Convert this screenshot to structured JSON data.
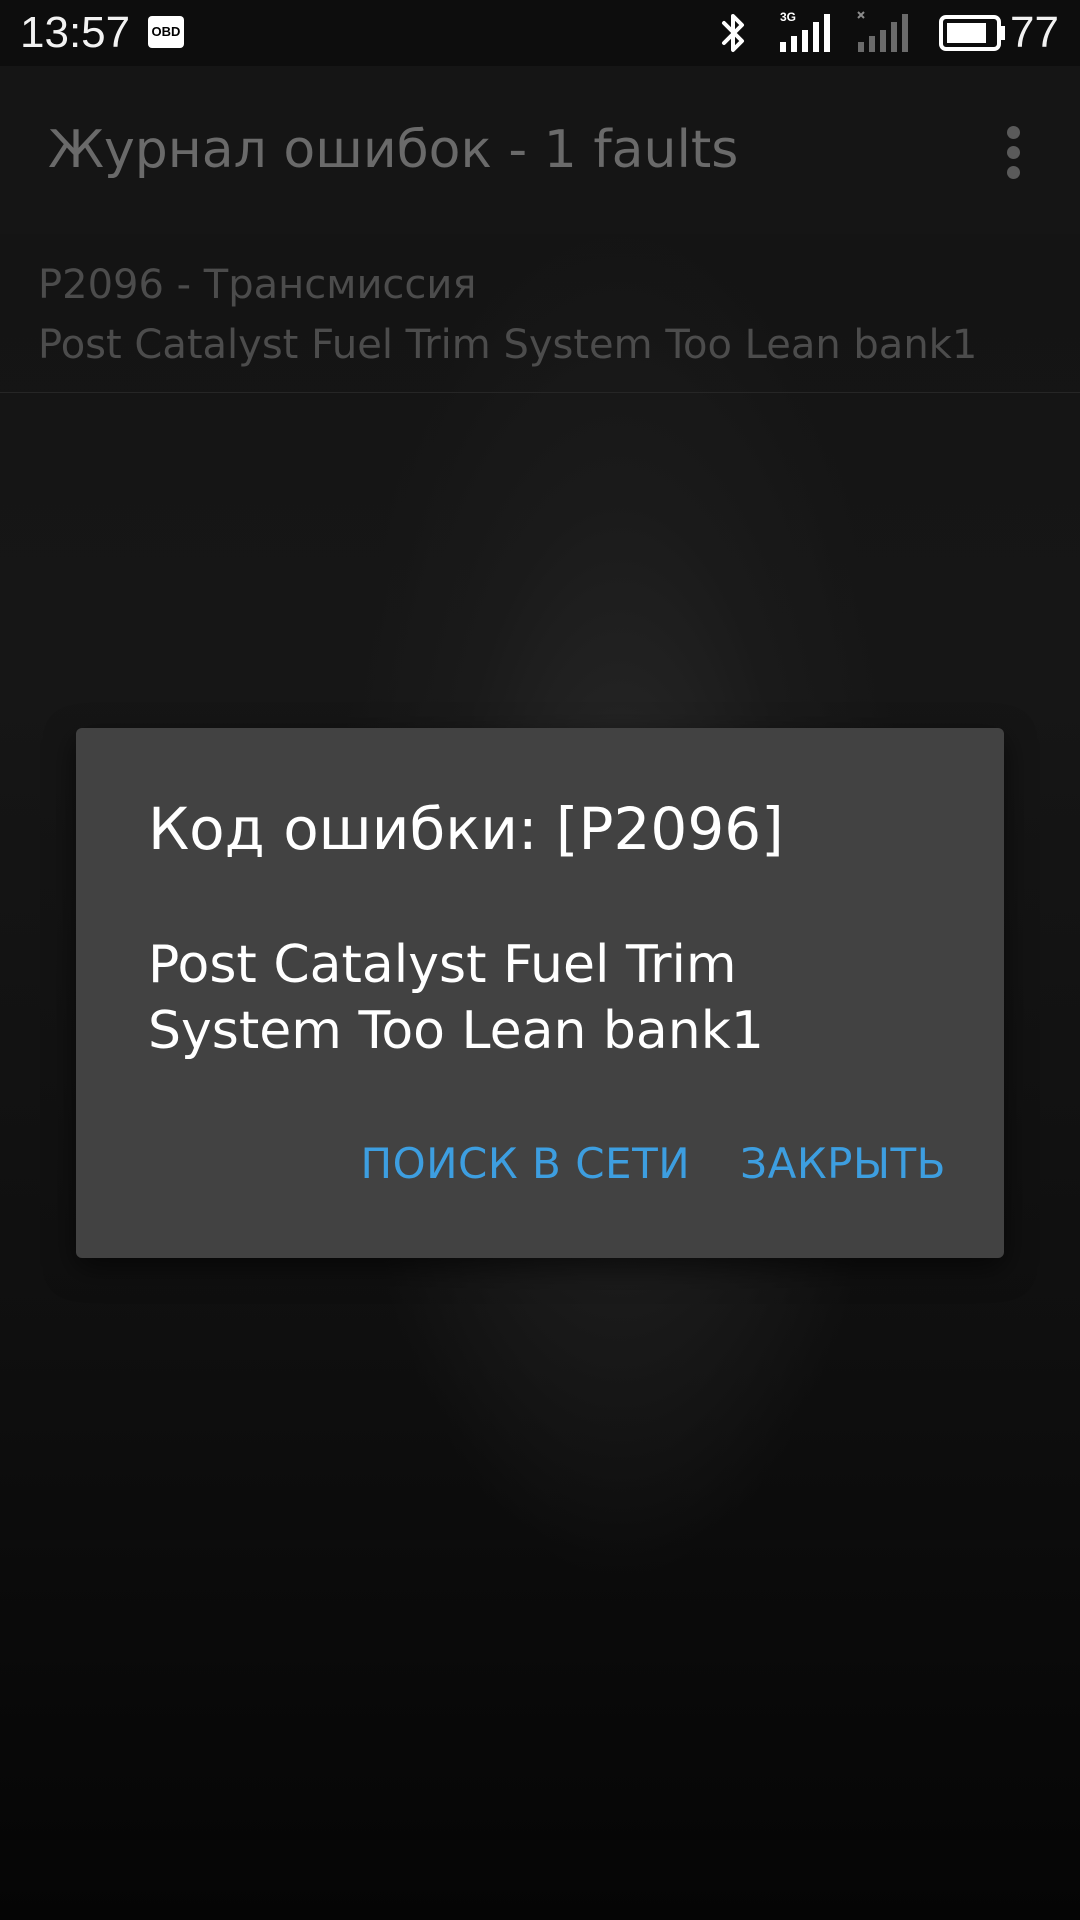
{
  "status_bar": {
    "time": "13:57",
    "obd_badge": "OBD",
    "network_type": "3G",
    "battery_percent": "77",
    "icons": [
      "bluetooth-icon",
      "signal-3g-icon",
      "signal-no-service-icon",
      "battery-icon"
    ]
  },
  "action_bar": {
    "title": "Журнал ошибок - 1 faults",
    "overflow_icon": "overflow-menu-icon"
  },
  "fault_list": {
    "items": [
      {
        "title": "P2096 - Трансмиссия",
        "description": "Post Catalyst Fuel Trim System Too Lean bank1"
      }
    ]
  },
  "dialog": {
    "title": "Код ошибки: [P2096]",
    "message": "Post Catalyst Fuel Trim System Too Lean bank1",
    "buttons": {
      "search": "ПОИСК В СЕТИ",
      "close": "ЗАКРЫТЬ"
    }
  },
  "colors": {
    "accent": "#3d9ee0",
    "dialog_background": "#424242",
    "dimmed_text": "#4c4c4c"
  }
}
